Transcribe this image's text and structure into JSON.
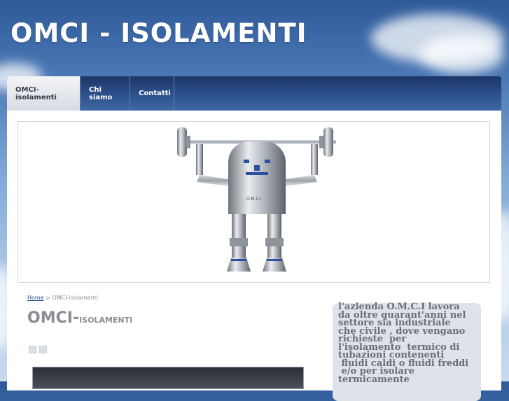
{
  "site": {
    "title": "OMCI - ISOLAMENTI"
  },
  "nav": {
    "items": [
      {
        "label": "OMCI-isolamenti"
      },
      {
        "label": "Chi siamo"
      },
      {
        "label": "Contatti"
      }
    ]
  },
  "breadcrumb": {
    "home": "Home",
    "separator": ">",
    "current": "OMCI-isolamenti"
  },
  "page": {
    "heading_first": "OMCI-",
    "heading_rest": "isolamenti"
  },
  "sidebar": {
    "text": "l'azienda O.M.C.I lavora\nda oltre quarant'anni nel\nsettore sia industriale\nche civile , dove vengano\nrichieste  per\nl'isolamento  termico di\ntubazioni contenenti\n fluidi caldi o fluidi freddi\n e/o per isolare\ntermicamente"
  },
  "hero": {
    "robot_badge": "O.M.C.I"
  },
  "colors": {
    "nav_dark": "#1c3768",
    "nav_active": "#e6e9ee",
    "heading_gray": "#8a8d93",
    "sidebar_bg": "#dfe2e8",
    "link_blue": "#2a4c86"
  }
}
